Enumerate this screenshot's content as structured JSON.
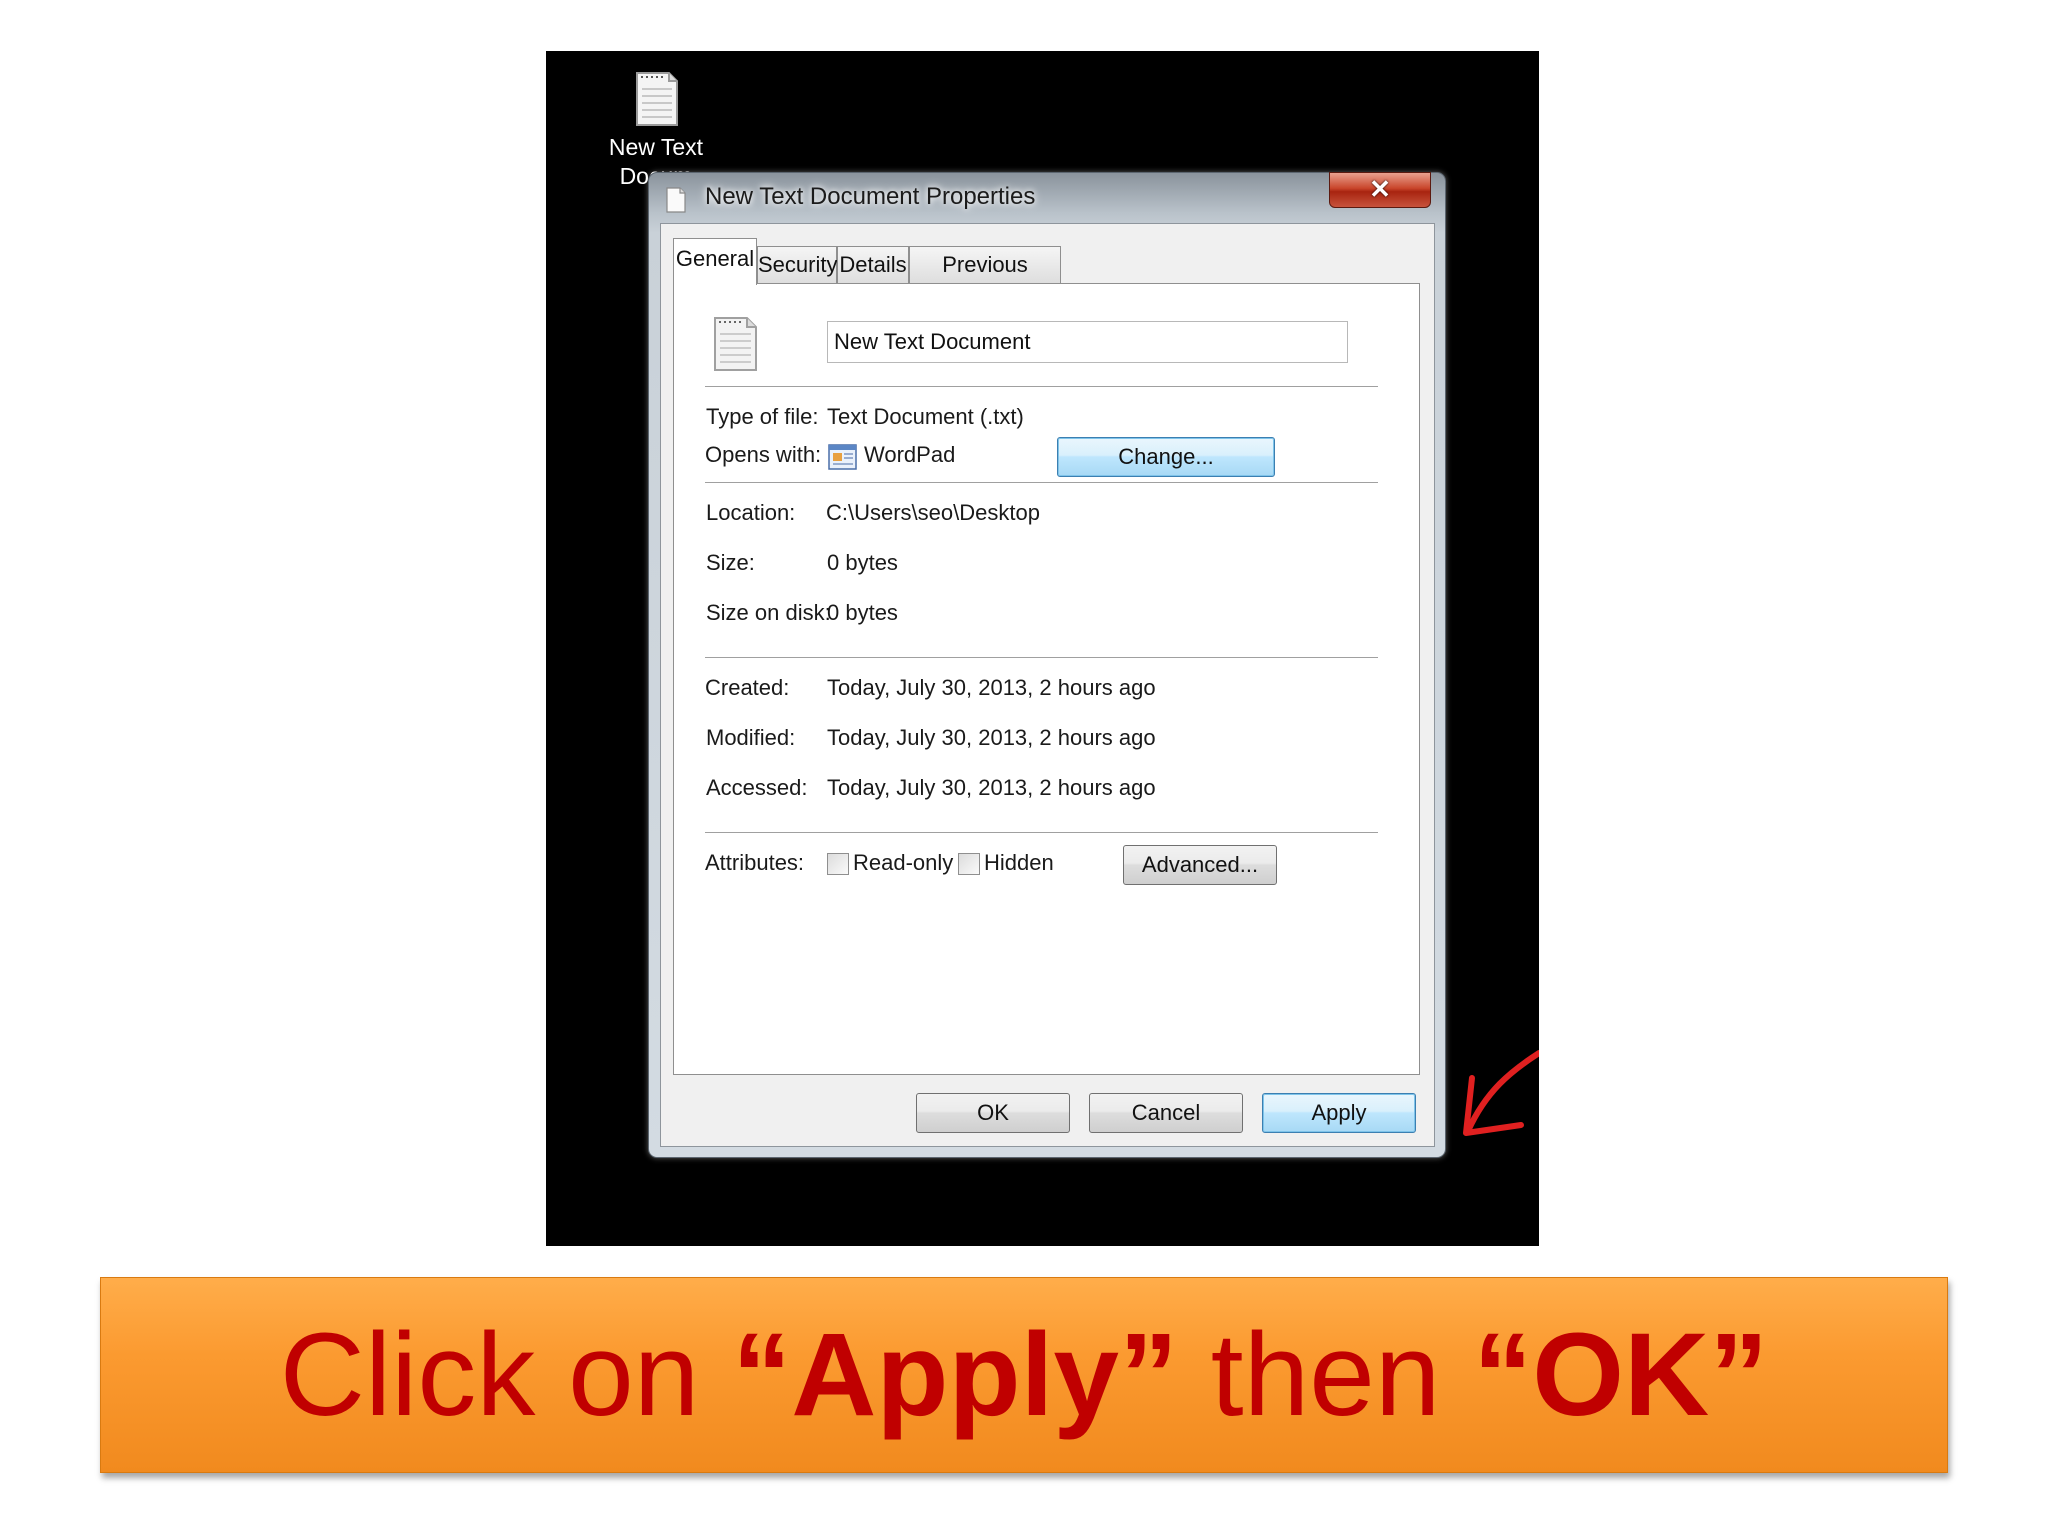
{
  "desktop": {
    "icon_label_line1": "New Text",
    "icon_label_line2": "Docum"
  },
  "dialog": {
    "title": "New Text Document Properties",
    "close_glyph": "✕",
    "tabs": [
      {
        "label": "General",
        "active": true
      },
      {
        "label": "Security",
        "active": false
      },
      {
        "label": "Details",
        "active": false
      },
      {
        "label": "Previous Versions",
        "active": false
      }
    ],
    "general": {
      "file_name": "New Text Document",
      "type_label": "Type of file:",
      "type_value": "Text Document (.txt)",
      "opens_label": "Opens with:",
      "opens_value": "WordPad",
      "change_button": "Change...",
      "location_label": "Location:",
      "location_value": "C:\\Users\\seo\\Desktop",
      "size_label": "Size:",
      "size_value": "0 bytes",
      "size_disk_label": "Size on disk:",
      "size_disk_value": "0 bytes",
      "created_label": "Created:",
      "created_value": "Today, July 30, 2013, 2 hours ago",
      "modified_label": "Modified:",
      "modified_value": "Today, July 30, 2013, 2 hours ago",
      "accessed_label": "Accessed:",
      "accessed_value": "Today, July 30, 2013, 2 hours ago",
      "attributes_label": "Attributes:",
      "readonly_label": "Read-only",
      "readonly_checked": false,
      "hidden_label": "Hidden",
      "hidden_checked": false,
      "advanced_button": "Advanced..."
    },
    "buttons": {
      "ok": "OK",
      "cancel": "Cancel",
      "apply": "Apply"
    }
  },
  "banner": {
    "part1": "Click on ",
    "part2": "“Apply”",
    "part3": " then ",
    "part4": "“OK”"
  },
  "colors": {
    "banner_bg": "#f7941d",
    "banner_text": "#c00000",
    "arrow": "#e02020"
  },
  "icons": {
    "desktop_file": "text-file-icon",
    "title": "text-file-icon",
    "opens_with": "wordpad-icon",
    "annotation": "red-arrow-icon"
  }
}
